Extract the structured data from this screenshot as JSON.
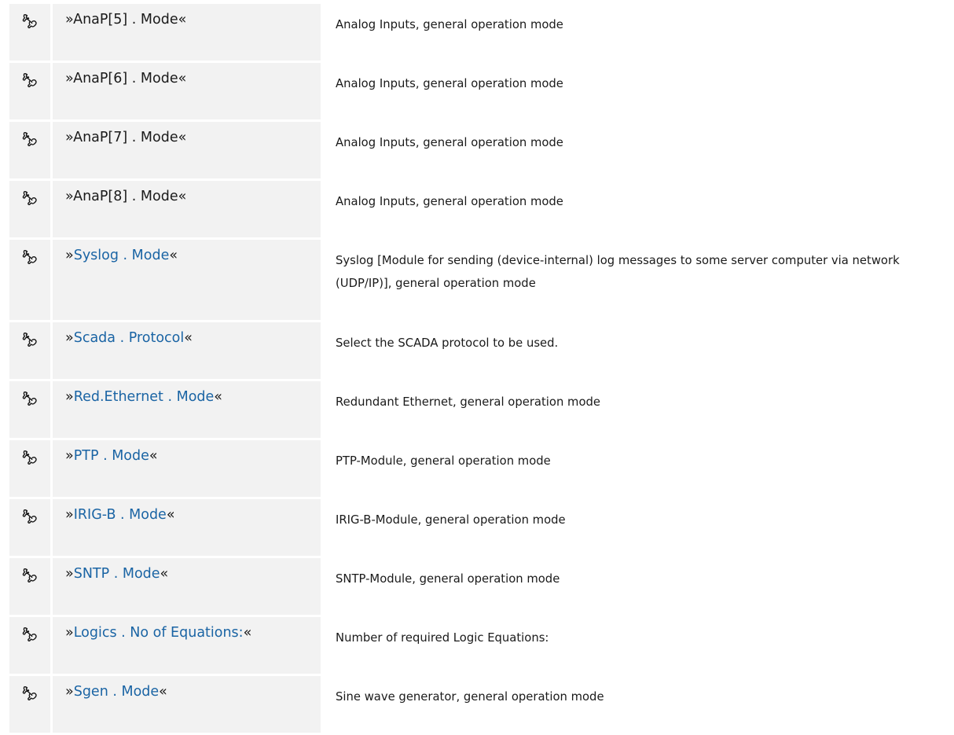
{
  "rows": [
    {
      "prefix": "»",
      "name": "AnaP[5] . Mode",
      "suffix": "«",
      "linked": false,
      "description": "Analog Inputs, general operation mode",
      "icon": "wrench-icon"
    },
    {
      "prefix": "»",
      "name": "AnaP[6] . Mode",
      "suffix": "«",
      "linked": false,
      "description": "Analog Inputs, general operation mode",
      "icon": "wrench-icon"
    },
    {
      "prefix": "»",
      "name": "AnaP[7] . Mode",
      "suffix": "«",
      "linked": false,
      "description": "Analog Inputs, general operation mode",
      "icon": "wrench-icon"
    },
    {
      "prefix": "»",
      "name": "AnaP[8] . Mode",
      "suffix": "«",
      "linked": false,
      "description": "Analog Inputs, general operation mode",
      "icon": "wrench-icon"
    },
    {
      "prefix": "»",
      "name": "Syslog . Mode",
      "suffix": "«",
      "linked": true,
      "description": "Syslog [Module for sending (device-internal) log messages to some server computer via network (UDP/IP)], general operation mode",
      "icon": "wrench-icon"
    },
    {
      "prefix": "»",
      "name": "Scada . Protocol",
      "suffix": "«",
      "linked": true,
      "description": "Select the SCADA protocol to be used.",
      "icon": "wrench-icon"
    },
    {
      "prefix": "»",
      "name": "Red.Ethernet . Mode",
      "suffix": "«",
      "linked": true,
      "description": "Redundant Ethernet, general operation mode",
      "icon": "wrench-icon"
    },
    {
      "prefix": "»",
      "name": "PTP . Mode",
      "suffix": "«",
      "linked": true,
      "description": "PTP-Module, general operation mode",
      "icon": "wrench-icon"
    },
    {
      "prefix": "»",
      "name": "IRIG-B . Mode",
      "suffix": "«",
      "linked": true,
      "description": "IRIG-B-Module, general operation mode",
      "icon": "wrench-icon"
    },
    {
      "prefix": "»",
      "name": "SNTP . Mode",
      "suffix": "«",
      "linked": true,
      "description": "SNTP-Module, general operation mode",
      "icon": "wrench-icon"
    },
    {
      "prefix": "»",
      "name": "Logics . No of Equations:",
      "suffix": "«",
      "linked": true,
      "description": "Number of required Logic Equations:",
      "icon": "wrench-icon"
    },
    {
      "prefix": "»",
      "name": "Sgen . Mode",
      "suffix": "«",
      "linked": true,
      "description": "Sine wave generator, general operation mode",
      "icon": "wrench-icon"
    }
  ],
  "colors": {
    "link": "#1a64a4",
    "row_background": "#f2f2f2",
    "text": "#1a1a1a"
  }
}
